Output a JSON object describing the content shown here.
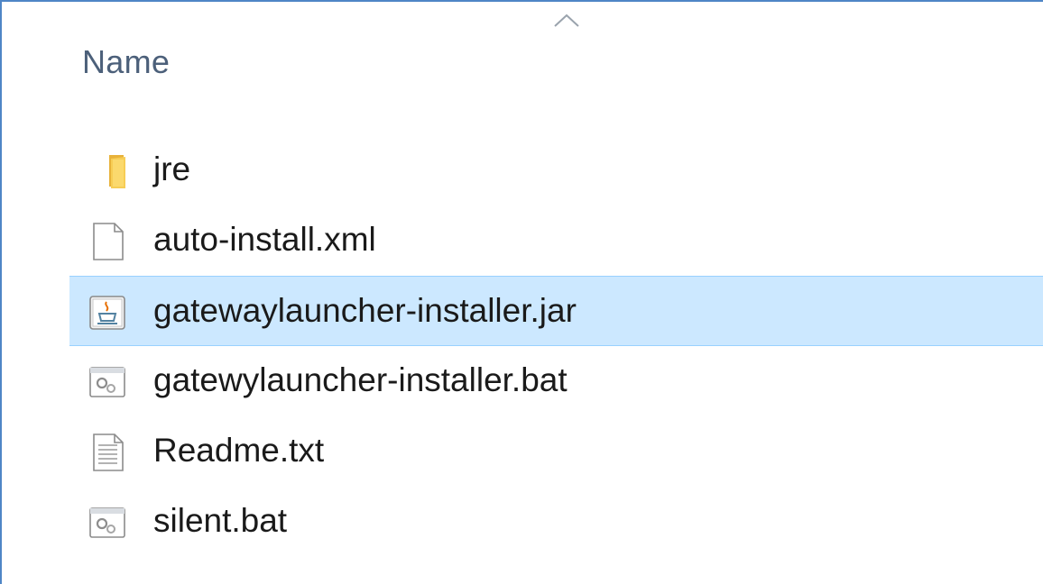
{
  "column_header": {
    "label": "Name",
    "sort_icon": "chevron-up-icon"
  },
  "files": [
    {
      "name": "jre",
      "icon": "folder-icon",
      "selected": false
    },
    {
      "name": "auto-install.xml",
      "icon": "blank-file-icon",
      "selected": false
    },
    {
      "name": "gatewaylauncher-installer.jar",
      "icon": "java-jar-icon",
      "selected": true
    },
    {
      "name": "gatewylauncher-installer.bat",
      "icon": "batch-file-icon",
      "selected": false
    },
    {
      "name": "Readme.txt",
      "icon": "text-file-icon",
      "selected": false
    },
    {
      "name": "silent.bat",
      "icon": "batch-file-icon",
      "selected": false
    }
  ],
  "colors": {
    "selection_background": "#cce8ff",
    "selection_border": "#99d1ff",
    "header_text": "#4c607a",
    "window_border": "#4f86c6",
    "folder": "#f5c542"
  }
}
